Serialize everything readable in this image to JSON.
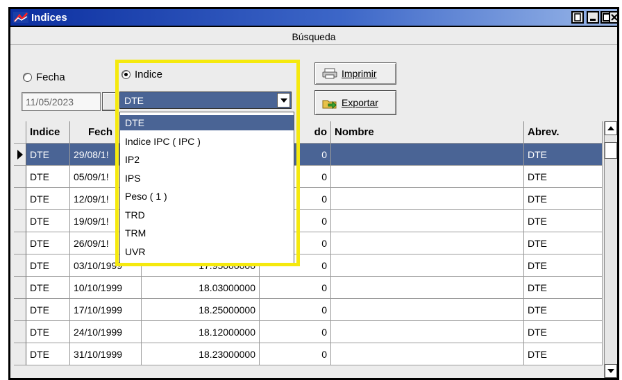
{
  "window": {
    "title": "Indices"
  },
  "search": {
    "label": "Búsqueda"
  },
  "filters": {
    "fecha_label": "Fecha",
    "indice_label": "Indice",
    "date_value": "11/05/2023",
    "combo_value": "DTE",
    "selected_radio": "Indice"
  },
  "buttons": {
    "imprimir_label": "Imprimir",
    "exportar_label": "Exportar"
  },
  "dropdown": {
    "options": [
      "DTE",
      "Indice IPC ( IPC )",
      "IP2",
      "IPS",
      "Peso ( 1 )",
      "TRD",
      "TRM",
      "UVR"
    ],
    "selected": "DTE"
  },
  "table": {
    "headers": [
      "Indice",
      "Fech",
      "",
      "do",
      "Nombre",
      "Abrev."
    ],
    "rows": [
      [
        "DTE",
        "29/08/1!",
        "",
        "0",
        "",
        "DTE"
      ],
      [
        "DTE",
        "05/09/1!",
        "",
        "0",
        "",
        "DTE"
      ],
      [
        "DTE",
        "12/09/1!",
        "",
        "0",
        "",
        "DTE"
      ],
      [
        "DTE",
        "19/09/1!",
        "",
        "0",
        "",
        "DTE"
      ],
      [
        "DTE",
        "26/09/1!",
        "",
        "0",
        "",
        "DTE"
      ],
      [
        "DTE",
        "03/10/1999",
        "17.95000000",
        "0",
        "",
        "DTE"
      ],
      [
        "DTE",
        "10/10/1999",
        "18.03000000",
        "0",
        "",
        "DTE"
      ],
      [
        "DTE",
        "17/10/1999",
        "18.25000000",
        "0",
        "",
        "DTE"
      ],
      [
        "DTE",
        "24/10/1999",
        "18.12000000",
        "0",
        "",
        "DTE"
      ],
      [
        "DTE",
        "31/10/1999",
        "18.23000000",
        "0",
        "",
        "DTE"
      ]
    ],
    "selected_row": 0
  },
  "colors": {
    "selection": "#4a6495",
    "highlight": "#f5e90e",
    "titlebar": "#0c2fa0"
  },
  "icons": [
    "app-icon",
    "minimize-icon",
    "maximize-icon",
    "close-icon",
    "printer-icon",
    "export-icon",
    "dropdown-arrow-icon",
    "row-pointer-icon",
    "scroll-up-icon",
    "scroll-down-icon"
  ]
}
